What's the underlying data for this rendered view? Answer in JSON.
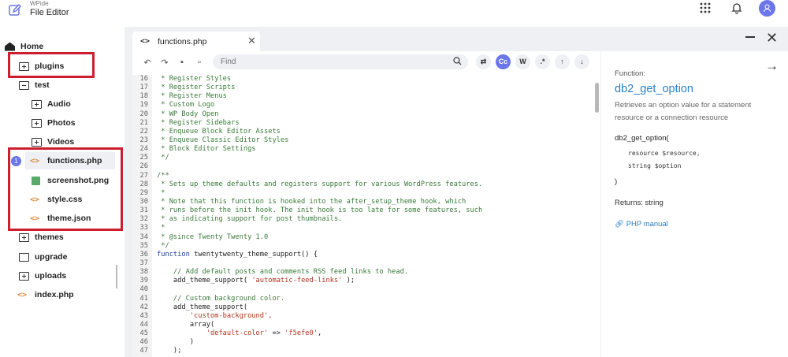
{
  "header": {
    "app_small": "WPide",
    "title": "File Editor",
    "icons": {
      "brand": "edit-icon",
      "apps": "grid-icon",
      "notifications": "bell-icon",
      "account": "avatar-icon"
    }
  },
  "sidebar": {
    "home": "Home",
    "plugins": "plugins",
    "test": "test",
    "audio": "Audio",
    "photos": "Photos",
    "videos": "Videos",
    "functions": "functions.php",
    "screenshot": "screenshot.png",
    "style": "style.css",
    "theme": "theme.json",
    "themes": "themes",
    "upgrade": "upgrade",
    "uploads": "uploads",
    "index": "index.php",
    "badge": "1",
    "highlight_color": "#cc1f2e"
  },
  "editor": {
    "tab_label": "functions.php",
    "code_icon": "<>",
    "find_placeholder": "Find",
    "btn_cc": "Cc",
    "btn_w": "W",
    "btn_regex": ".*",
    "lines": [
      {
        "n": "16",
        "t": " * Register Styles",
        "k": "com"
      },
      {
        "n": "17",
        "t": " * Register Scripts",
        "k": "com"
      },
      {
        "n": "18",
        "t": " * Register Menus",
        "k": "com"
      },
      {
        "n": "19",
        "t": " * Custom Logo",
        "k": "com"
      },
      {
        "n": "20",
        "t": " * WP Body Open",
        "k": "com"
      },
      {
        "n": "21",
        "t": " * Register Sidebars",
        "k": "com"
      },
      {
        "n": "22",
        "t": " * Enqueue Block Editor Assets",
        "k": "com"
      },
      {
        "n": "23",
        "t": " * Enqueue Classic Editor Styles",
        "k": "com"
      },
      {
        "n": "24",
        "t": " * Block Editor Settings",
        "k": "com"
      },
      {
        "n": "25",
        "t": " */",
        "k": "com"
      },
      {
        "n": "26",
        "t": "",
        "k": "plain"
      },
      {
        "n": "27",
        "t": "/**",
        "k": "com"
      },
      {
        "n": "28",
        "t": " * Sets up theme defaults and registers support for various WordPress features.",
        "k": "com"
      },
      {
        "n": "29",
        "t": " *",
        "k": "com"
      },
      {
        "n": "30",
        "t": " * Note that this function is hooked into the after_setup_theme hook, which",
        "k": "com"
      },
      {
        "n": "31",
        "t": " * runs before the init hook. The init hook is too late for some features, such",
        "k": "com"
      },
      {
        "n": "32",
        "t": " * as indicating support for post thumbnails.",
        "k": "com"
      },
      {
        "n": "33",
        "t": " *",
        "k": "com"
      },
      {
        "n": "34",
        "t": " * @since Twenty Twenty 1.0",
        "k": "com"
      },
      {
        "n": "35",
        "t": " */",
        "k": "com"
      },
      {
        "n": "36",
        "t": "function twentytwenty_theme_support() {",
        "k": "func"
      },
      {
        "n": "37",
        "t": "",
        "k": "plain"
      },
      {
        "n": "38",
        "t": "    // Add default posts and comments RSS feed links to head.",
        "k": "com"
      },
      {
        "n": "39",
        "t": "    add_theme_support( 'automatic-feed-links' );",
        "k": "call1"
      },
      {
        "n": "40",
        "t": "",
        "k": "plain"
      },
      {
        "n": "41",
        "t": "    // Custom background color.",
        "k": "com"
      },
      {
        "n": "42",
        "t": "    add_theme_support(",
        "k": "plain"
      },
      {
        "n": "43",
        "t": "        'custom-background',",
        "k": "str"
      },
      {
        "n": "44",
        "t": "        array(",
        "k": "plain"
      },
      {
        "n": "45",
        "t": "            'default-color' => 'f5efe0',",
        "k": "pair"
      },
      {
        "n": "46",
        "t": "        )",
        "k": "plain"
      },
      {
        "n": "47",
        "t": "    );",
        "k": "plain"
      }
    ]
  },
  "info": {
    "label": "Function:",
    "name": "db2_get_option",
    "description": "Retrieves an option value for a statement resource or a connection resource",
    "sig_open": "db2_get_option(",
    "arg1": "resource $resource,",
    "arg2": "string $option",
    "sig_close": ")",
    "returns": "Returns: string",
    "manual": "PHP manual",
    "name_color": "#2b7fc6"
  }
}
